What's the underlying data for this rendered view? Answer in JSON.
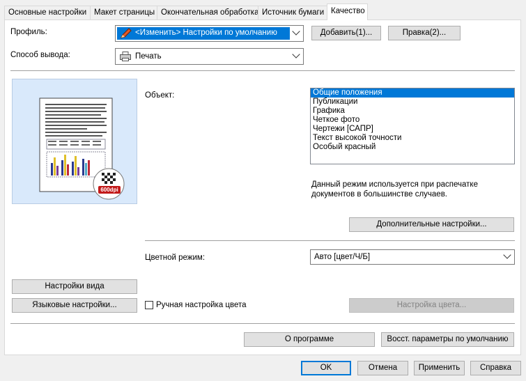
{
  "tabs": [
    "Основные настройки",
    "Макет страницы",
    "Окончательная обработка",
    "Источник бумаги",
    "Качество"
  ],
  "profile": {
    "label": "Профиль:",
    "value": "<Изменить> Настройки по умолчанию",
    "add_button": "Добавить(1)...",
    "edit_button": "Правка(2)..."
  },
  "output": {
    "label": "Способ вывода:",
    "value": "Печать"
  },
  "preview": {
    "dpi_badge": "600dpi"
  },
  "object": {
    "label": "Объект:",
    "items": [
      "Общие положения",
      "Публикации",
      "Графика",
      "Четкое фото",
      "Чертежи [САПР]",
      "Текст высокой точности",
      "Особый красный"
    ],
    "selected_index": 0,
    "description_line1": "Данный режим используется при распечатке",
    "description_line2": "документов в большинстве случаев.",
    "advanced_button": "Дополнительные настройки..."
  },
  "color_mode": {
    "label": "Цветной режим:",
    "value": "Авто [цвет/Ч/Б]"
  },
  "left_buttons": {
    "view_settings": "Настройки вида",
    "language_settings": "Языковые настройки..."
  },
  "manual_color": {
    "label": "Ручная настройка цвета",
    "checked": false,
    "button": "Настройка цвета..."
  },
  "footer_panel": {
    "about": "О программе",
    "restore_defaults": "Восст. параметры по умолчанию"
  },
  "dialog_buttons": {
    "ok": "OK",
    "cancel": "Отмена",
    "apply": "Применить",
    "help": "Справка"
  },
  "colors": {
    "accent": "#0078d7",
    "preview_bg": "#d9e9fb",
    "panel_bg": "#ffffff",
    "window_bg": "#f0f0f0"
  }
}
